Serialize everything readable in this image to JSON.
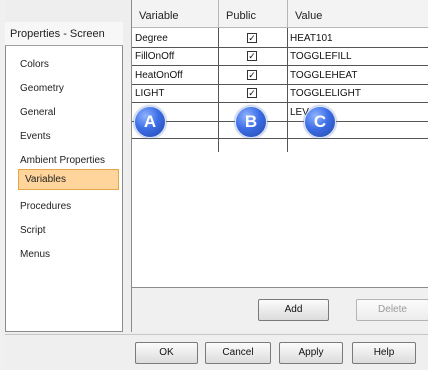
{
  "window": {
    "panel_title": "Properties - Screen"
  },
  "sidebar": {
    "items": [
      {
        "label": "Colors"
      },
      {
        "label": "Geometry"
      },
      {
        "label": "General"
      },
      {
        "label": "Events"
      },
      {
        "label": "Ambient Properties"
      },
      {
        "label": "Variables",
        "selected": true
      },
      {
        "label": "Procedures"
      },
      {
        "label": "Script"
      },
      {
        "label": "Menus"
      }
    ]
  },
  "grid": {
    "columns": [
      "Variable",
      "Public",
      "Value"
    ],
    "rows": [
      {
        "variable": "Degree",
        "public": true,
        "value": "HEAT101"
      },
      {
        "variable": "FillOnOff",
        "public": true,
        "value": "TOGGLEFILL"
      },
      {
        "variable": "HeatOnOff",
        "public": true,
        "value": "TOGGLEHEAT"
      },
      {
        "variable": "LIGHT",
        "public": true,
        "value": "TOGGLELIGHT"
      },
      {
        "variable": "",
        "public": false,
        "value": "LEV    01"
      }
    ]
  },
  "callouts": [
    "A",
    "B",
    "C"
  ],
  "buttons": {
    "add": "Add",
    "delete": "Delete",
    "ok": "OK",
    "cancel": "Cancel",
    "apply": "Apply",
    "help": "Help"
  },
  "colors": {
    "selected_fill": "#ffd59b",
    "callout_blue": "#3d6ee6"
  }
}
